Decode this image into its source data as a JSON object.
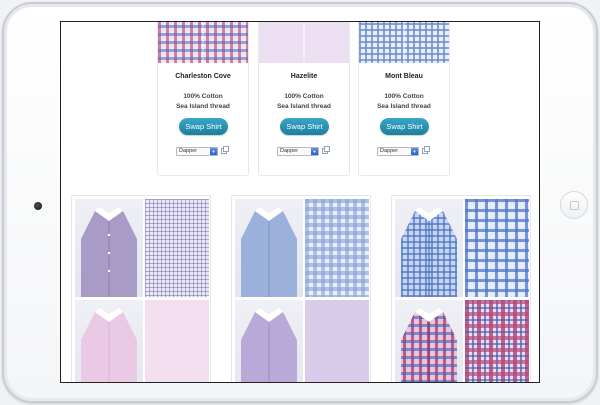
{
  "device": {
    "frame": "ipad-landscape",
    "camera_icon": "camera-dot-icon",
    "home_button_icon": "home-button-icon"
  },
  "products": [
    {
      "name": "Charleston Cove",
      "material": "100% Cotton",
      "thread": "Sea Island thread",
      "button_label": "Swap Shirt",
      "style_value": "Dapper",
      "swatch_color": "#c05a8f"
    },
    {
      "name": "Hazelite",
      "material": "100% Cotton",
      "thread": "Sea Island thread",
      "button_label": "Swap Shirt",
      "style_value": "Dapper",
      "swatch_color": "#e8dcef"
    },
    {
      "name": "Mont Bleau",
      "material": "100% Cotton",
      "thread": "Sea Island thread",
      "button_label": "Swap Shirt",
      "style_value": "Dapper",
      "swatch_color": "#6f8fcf"
    }
  ],
  "grid": [
    {
      "shirt_color": "#a89cc6",
      "pattern": "fine-check",
      "pattern_color": "#7f78b8"
    },
    {
      "shirt_color": "#9bb1dc",
      "pattern": "gingham",
      "pattern_color": "#86a2d8"
    },
    {
      "shirt_color": "#7f9ed8",
      "pattern": "check",
      "pattern_color": "#4f76c8"
    },
    {
      "shirt_color": "#eac9e6",
      "pattern": "solid",
      "pattern_color": "#f3dff0"
    },
    {
      "shirt_color": "#b9a9d8",
      "pattern": "solid",
      "pattern_color": "#d9ccea"
    },
    {
      "shirt_color": "#b04a7e",
      "pattern": "tartan",
      "pattern_color": "#a73a78"
    }
  ],
  "colors": {
    "accent": "#1f86a8",
    "card_border": "#e6e6e8"
  }
}
